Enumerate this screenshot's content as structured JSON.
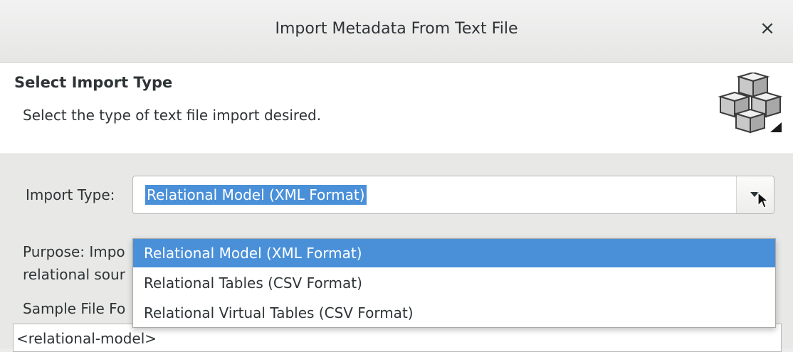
{
  "window": {
    "title": "Import Metadata From Text File",
    "close_glyph": "×"
  },
  "header": {
    "title": "Select Import Type",
    "description": "Select the type of text file import desired.",
    "icon": "cubes-icon"
  },
  "form": {
    "import_type_label": "Import Type:",
    "import_type_value": "Relational Model (XML Format)",
    "purpose_line1": "Purpose: Impo",
    "purpose_line2": "relational sour",
    "sample_label": "Sample File Fo",
    "sample_content": "<relational-model>"
  },
  "dropdown": {
    "options": [
      {
        "label": "Relational Model (XML Format)",
        "selected": true
      },
      {
        "label": "Relational Tables (CSV Format)",
        "selected": false
      },
      {
        "label": "Relational Virtual Tables (CSV Format)",
        "selected": false
      }
    ]
  },
  "colors": {
    "accent": "#4a90d9",
    "background": "#e8e8e7",
    "header_bg": "#ffffff"
  }
}
